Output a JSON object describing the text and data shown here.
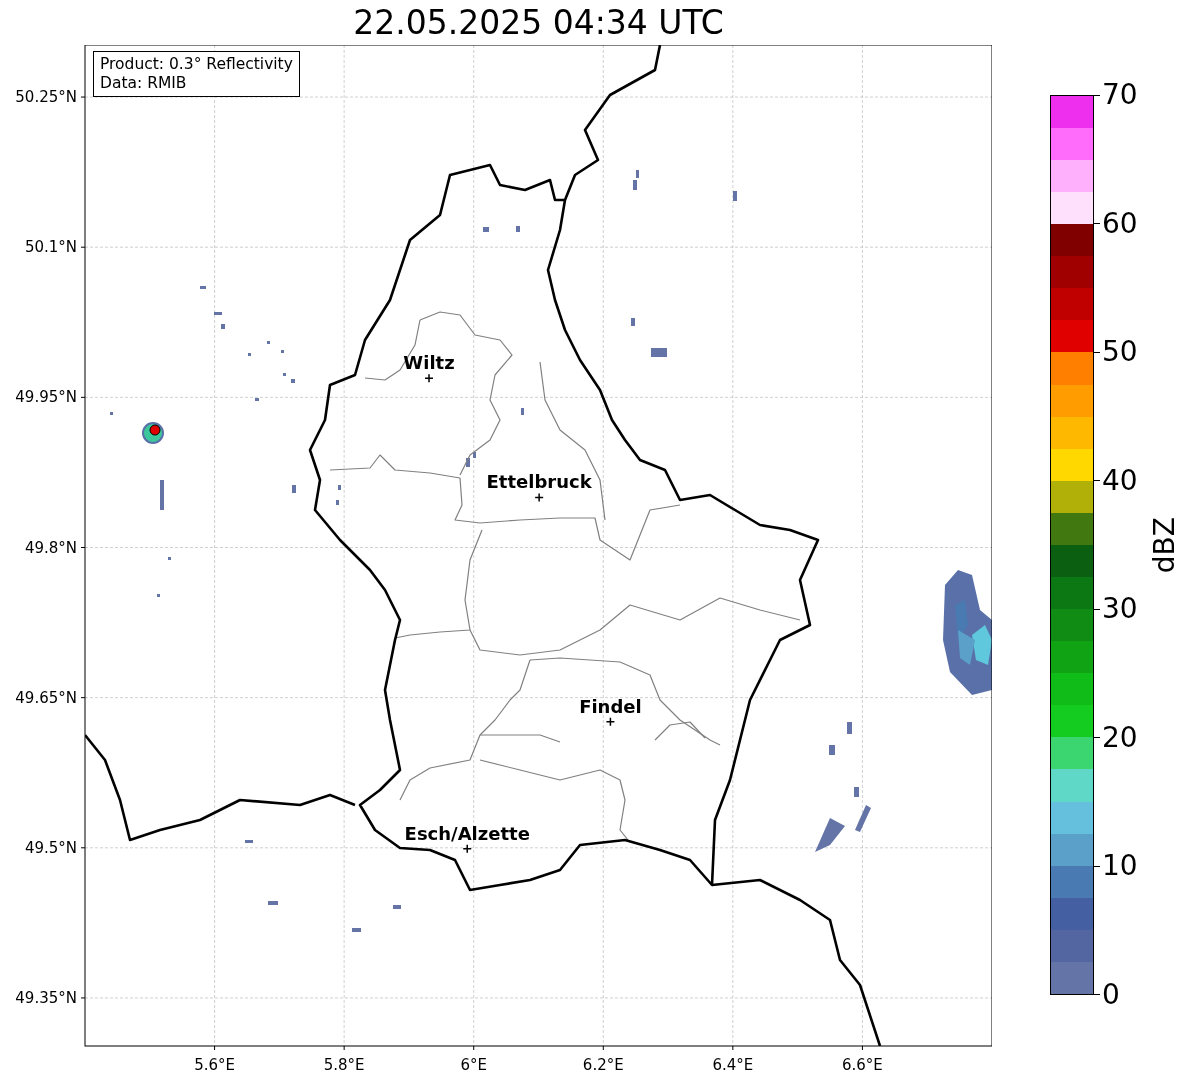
{
  "title": "22.05.2025 04:34 UTC",
  "info": [
    "Product: 0.3° Reflectivity",
    "Data: RMIB"
  ],
  "map": {
    "xticks": [
      "5.6°E",
      "5.8°E",
      "6°E",
      "6.2°E",
      "6.4°E",
      "6.6°E"
    ],
    "yticks": [
      "50.25°N",
      "50.1°N",
      "49.95°N",
      "49.8°N",
      "49.65°N",
      "49.5°N",
      "49.35°N"
    ],
    "cities": [
      {
        "name": "Wiltz"
      },
      {
        "name": "Ettelbruck"
      },
      {
        "name": "Findel"
      },
      {
        "name": "Esch/Alzette"
      }
    ]
  },
  "colorbar": {
    "label": "dBZ",
    "ticks": [
      "70",
      "60",
      "50",
      "40",
      "30",
      "20",
      "10",
      "0"
    ]
  }
}
